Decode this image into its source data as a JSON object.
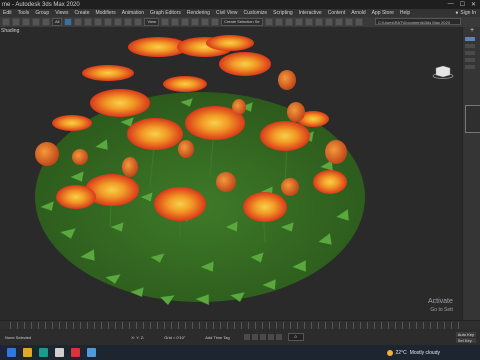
{
  "window": {
    "title": "me - Autodesk 3ds Max 2020",
    "controls": [
      "—",
      "☐",
      "✕"
    ]
  },
  "menu": {
    "items": [
      "Edit",
      "Tools",
      "Group",
      "Views",
      "Create",
      "Modifiers",
      "Animation",
      "Graph Editors",
      "Rendering",
      "Civil View",
      "Customize",
      "Scripting",
      "Interactive",
      "Content",
      "Arnold",
      "App Store",
      "Help"
    ],
    "sign_in": "Sign In"
  },
  "toolbar": {
    "dropdown_all": "All",
    "dropdown_view": "View",
    "selection_set": "Create Selection Se",
    "path": "C:\\Users\\RAT\\Documents\\3ds Max 2020"
  },
  "viewport": {
    "label": "[+] [Perspective] [Shading]",
    "label_short": "Shading"
  },
  "watermark": {
    "line1": "Activate",
    "line2": "Go to Sett"
  },
  "status": {
    "selected": "None Selected",
    "coords": "X:  Y:  Z:",
    "grid": "Grid = 0'10\"",
    "add_time_tag": "Add Time Tag",
    "frame": "0",
    "auto_key": "Auto Key",
    "set_key": "Set Key",
    "selected_btn": "Selected"
  },
  "taskbar": {
    "weather_temp": "22°C",
    "weather_text": "Mostly cloudy"
  },
  "colors": {
    "petal_outer": "#e8501a",
    "petal_inner": "#f7c23a",
    "leaf": "#4f9a36",
    "background": "#2a2a2a"
  }
}
